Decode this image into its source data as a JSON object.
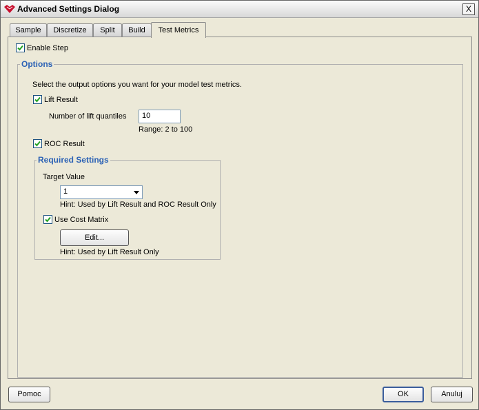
{
  "window": {
    "title": "Advanced Settings Dialog",
    "close_glyph": "X"
  },
  "tabs": [
    {
      "label": "Sample"
    },
    {
      "label": "Discretize"
    },
    {
      "label": "Split"
    },
    {
      "label": "Build"
    },
    {
      "label": "Test Metrics",
      "active": true
    }
  ],
  "enable_step": {
    "label": "Enable Step",
    "checked": true
  },
  "options": {
    "legend": "Options",
    "description": "Select the output options you want for your model test metrics.",
    "lift_result": {
      "label": "Lift Result",
      "checked": true
    },
    "lift_quantiles": {
      "label": "Number of lift quantiles",
      "value": "10",
      "range": "Range: 2 to 100"
    },
    "roc_result": {
      "label": "ROC Result",
      "checked": true
    }
  },
  "required_settings": {
    "legend": "Required Settings",
    "target_value_label": "Target Value",
    "target_value": "1",
    "target_hint": "Hint: Used by Lift Result and ROC Result Only",
    "use_cost_matrix": {
      "label": "Use Cost Matrix",
      "checked": true
    },
    "edit_button": "Edit...",
    "edit_hint": "Hint: Used by Lift Result Only"
  },
  "footer": {
    "help": "Pomoc",
    "ok": "OK",
    "cancel": "Anuluj"
  },
  "colors": {
    "accent": "#2c62b5",
    "check": "#21a121",
    "background": "#ece9d8"
  }
}
